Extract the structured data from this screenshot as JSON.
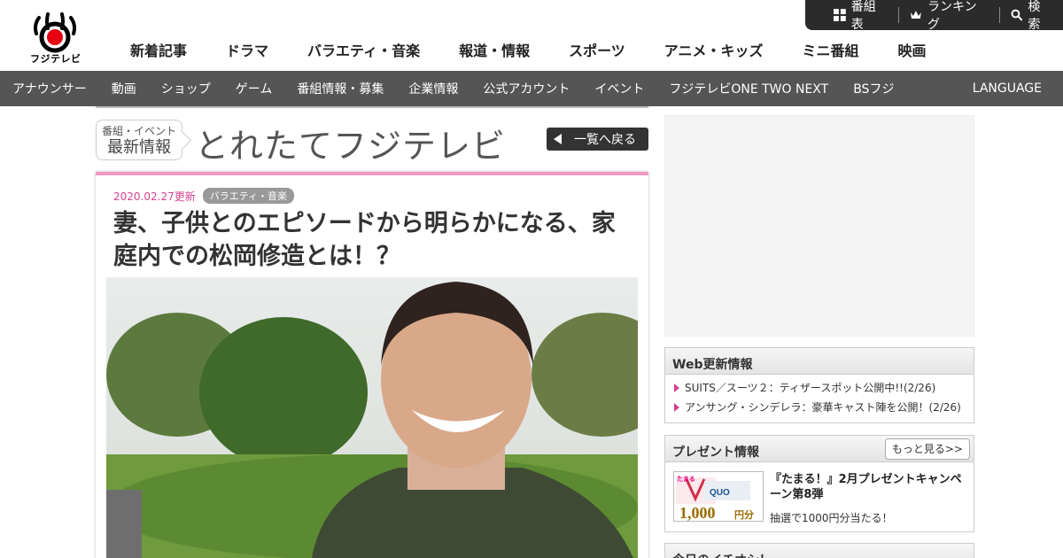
{
  "brand": {
    "logo_text": "フジテレビ"
  },
  "top_utility": [
    {
      "label": "番組表",
      "icon": "grid-icon"
    },
    {
      "label": "ランキング",
      "icon": "crown-icon"
    },
    {
      "label": "検索",
      "icon": "search-icon"
    }
  ],
  "global_nav": [
    "新着記事",
    "ドラマ",
    "バラエティ・音楽",
    "報道・情報",
    "スポーツ",
    "アニメ・キッズ",
    "ミニ番組",
    "映画"
  ],
  "sub_nav": {
    "items": [
      "アナウンサー",
      "動画",
      "ショップ",
      "ゲーム",
      "番組情報・募集",
      "企業情報",
      "公式アカウント",
      "イベント",
      "フジテレビONE TWO NEXT",
      "BSフジ"
    ],
    "language": "LANGUAGE"
  },
  "section": {
    "badge_line1": "番組・イベント",
    "badge_line2": "最新情報",
    "title": "とれたてフジテレビ",
    "back_label": "一覧へ戻る"
  },
  "article": {
    "date": "2020.02.27更新",
    "category": "バラエティ・音楽",
    "headline": "妻、子供とのエピソードから明らかになる、家庭内での松岡修造とは！？"
  },
  "sidebar": {
    "web_updates": {
      "title": "Web更新情報",
      "items": [
        "SUITS／スーツ２：ティザースポット公開中!!(2/26)",
        "アンサング・シンデレラ：豪華キャスト陣を公開！(2/26)"
      ]
    },
    "present": {
      "title": "プレゼント情報",
      "more_label": "もっと見る>>",
      "item_title": "『たまる！』2月プレゼントキャンペーン第8弾",
      "item_desc": "抽選で1000円分当たる！",
      "thumb_brand": "たまる",
      "thumb_quo": "QUO",
      "thumb_amount": "1,000",
      "thumb_unit": "円分"
    },
    "next_box_title": "今日のイチオシ！"
  },
  "colors": {
    "accent_pink": "#d6418f",
    "border_pink": "#f29ac6",
    "subnav_bg": "#555555",
    "util_bg": "#2b2b2b"
  }
}
